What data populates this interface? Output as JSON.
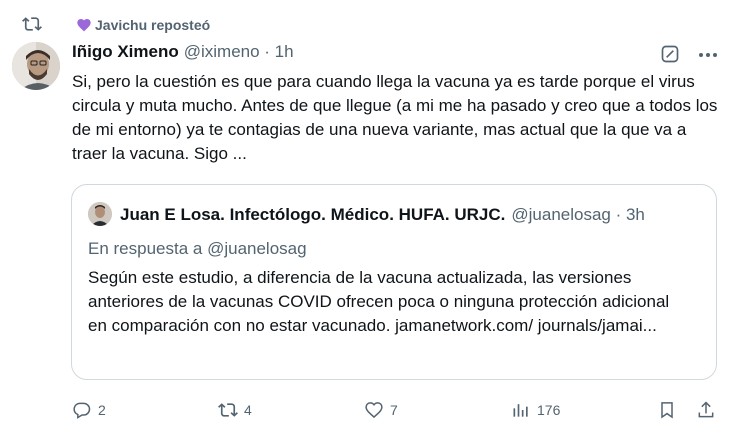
{
  "repost": {
    "text": "Javichu reposteó"
  },
  "tweet": {
    "author_name": "Iñigo Ximeno",
    "meta": "@iximeno · 1h",
    "text": "Si, pero la cuestión es que para cuando llega la vacuna ya es tarde porque el virus circula y muta mucho. Antes de que llegue (a mi me ha pasado y creo que a todos los de mi entorno) ya te contagias de una nueva variante, mas actual que la que va a traer la vacuna. Sigo ..."
  },
  "quote": {
    "author_name": "Juan E Losa. Infectólogo. Médico. HUFA. URJC.",
    "meta": "@juanelosag · 3h",
    "reply_to": "En respuesta a @juanelosag",
    "text": "Según este estudio, a diferencia de la vacuna actualizada, las versiones anteriores de la vacunas COVID ofrecen poca o ninguna protección adicional en comparación con no estar vacunado. jamanetwork.com/ journals/jamai..."
  },
  "actions": {
    "replies": "2",
    "reposts": "4",
    "likes": "7",
    "views": "176"
  },
  "colors": {
    "text": "#0f1419",
    "secondary": "#536471",
    "border": "#cfd9de",
    "heart": "#9a68d8"
  },
  "icons": [
    "repost-icon",
    "purple-heart-icon",
    "grok-icon",
    "more-icon",
    "reply-icon",
    "retweet-icon",
    "like-icon",
    "views-icon",
    "bookmark-icon",
    "share-icon"
  ]
}
